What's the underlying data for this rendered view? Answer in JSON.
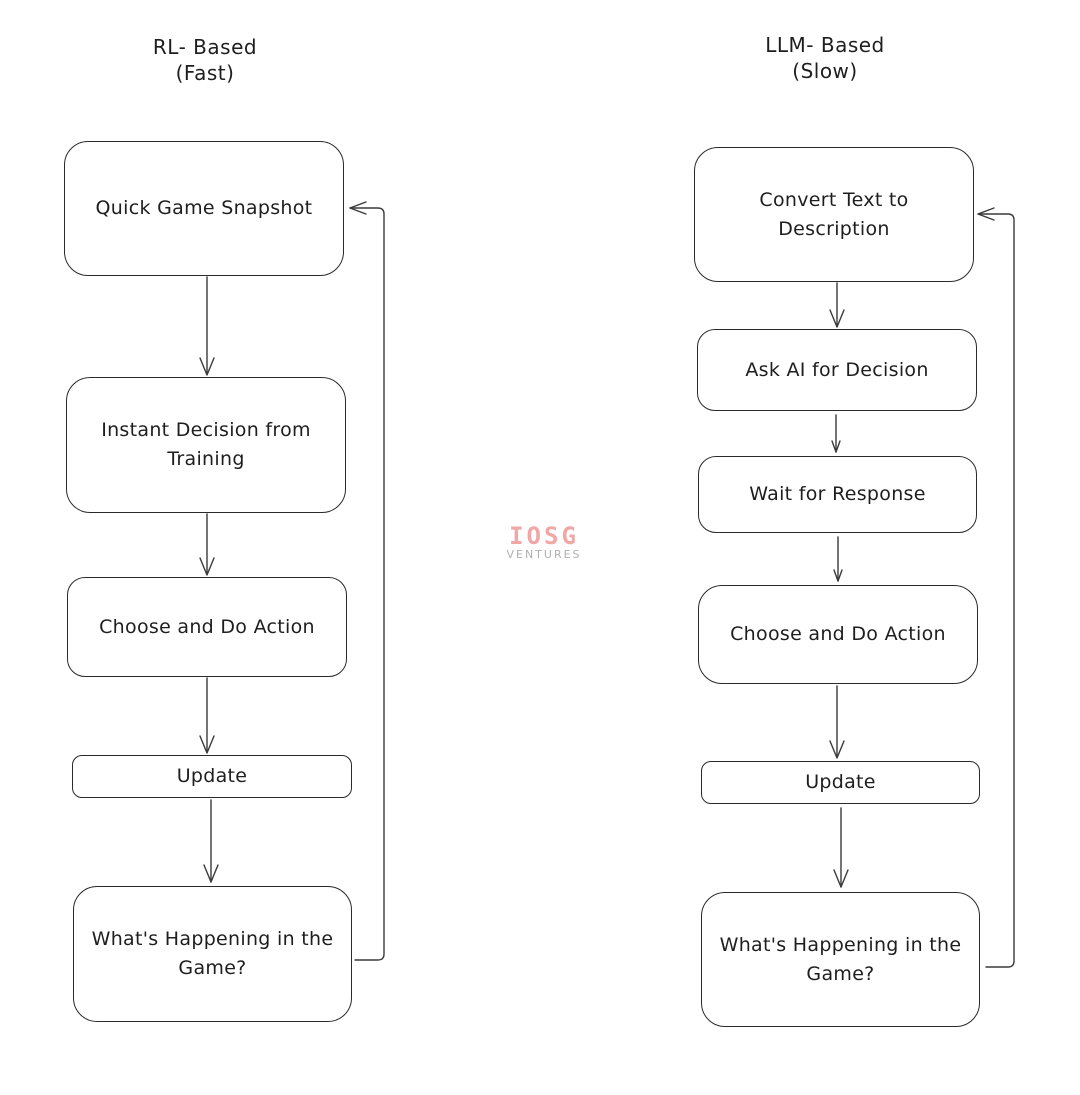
{
  "diagram": {
    "left": {
      "title_line1": "RL- Based",
      "title_line2": "(Fast)",
      "nodes": [
        {
          "label": "Quick Game Snapshot"
        },
        {
          "label": "Instant Decision from Training"
        },
        {
          "label": "Choose and Do Action"
        },
        {
          "label": "Update"
        },
        {
          "label": "What's Happening in the Game?"
        }
      ],
      "loop": {
        "from": "What's Happening in the Game?",
        "to": "Quick Game Snapshot"
      }
    },
    "right": {
      "title_line1": "LLM- Based",
      "title_line2": "(Slow)",
      "nodes": [
        {
          "label": "Convert Text to Description"
        },
        {
          "label": "Ask AI for Decision"
        },
        {
          "label": "Wait for Response"
        },
        {
          "label": "Choose and Do Action"
        },
        {
          "label": "Update"
        },
        {
          "label": "What's Happening in the Game?"
        }
      ],
      "loop": {
        "from": "What's Happening in the Game?",
        "to": "Convert Text to Description"
      }
    },
    "watermark": {
      "logo": "IOSG",
      "subtitle": "VENTURES",
      "logo_color": "#f2a7a7"
    },
    "stroke_color": "#2a2a2a"
  }
}
